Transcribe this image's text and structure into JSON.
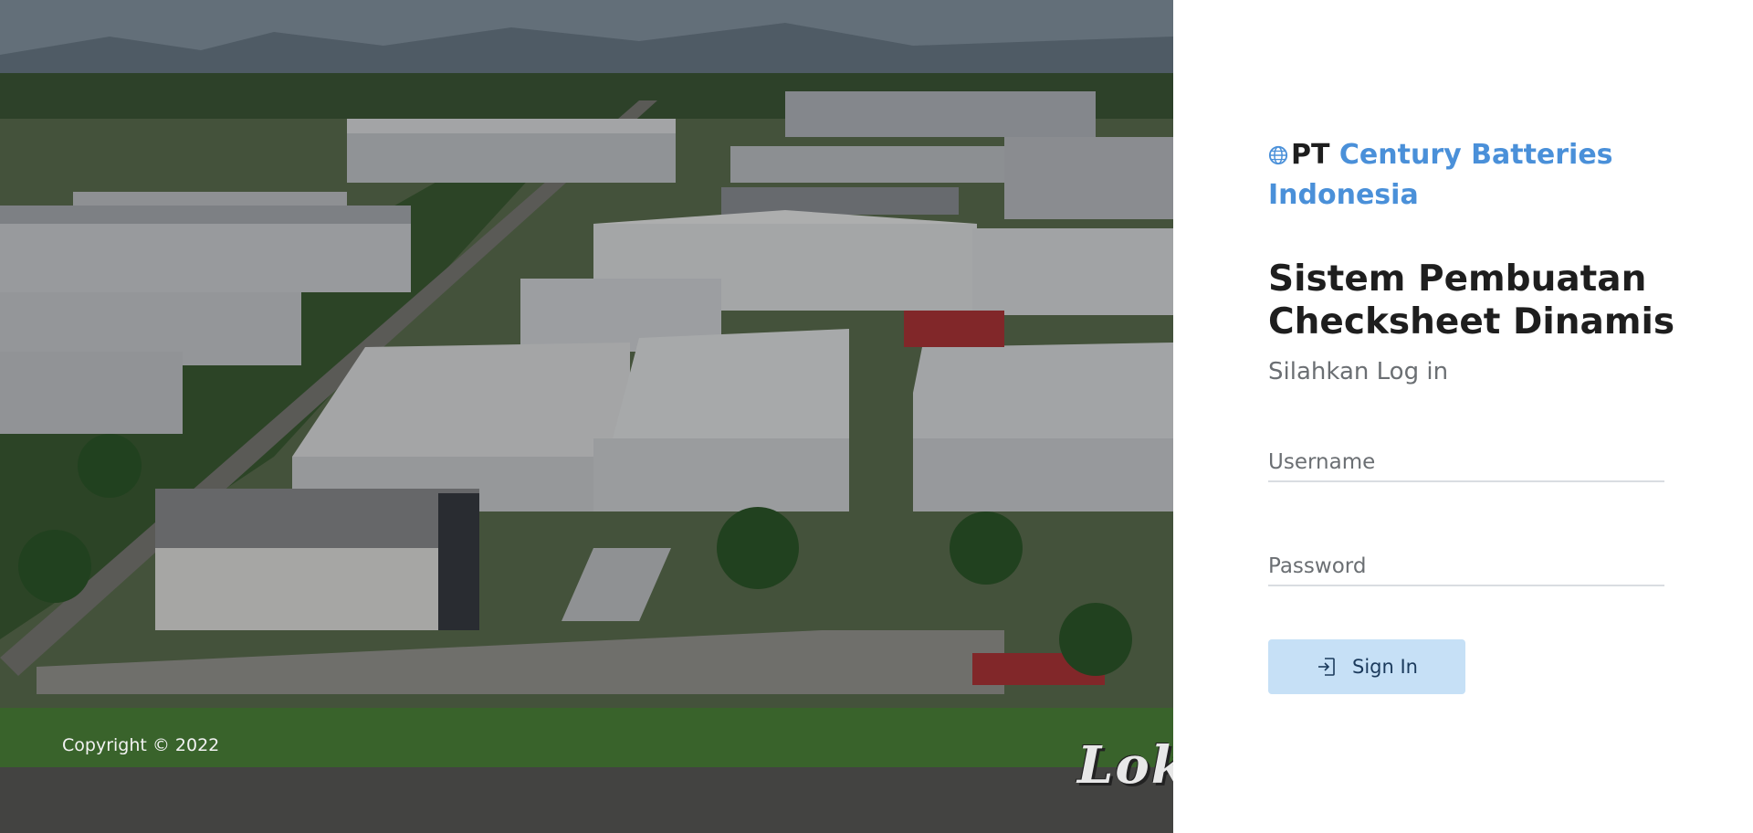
{
  "hero": {
    "copyright": "Copyright © 2022",
    "watermark": "Lok"
  },
  "login": {
    "company_prefix": "PT",
    "company_name": "Century Batteries Indonesia",
    "title": "Sistem Pembuatan Checksheet Dinamis",
    "subtitle": "Silahkan Log in",
    "username_placeholder": "Username",
    "password_placeholder": "Password",
    "signin_label": "Sign In"
  },
  "icons": {
    "company": "globe-icon",
    "signin": "sign-in-icon"
  },
  "colors": {
    "accent": "#4a90d9",
    "button_bg": "#c6e0f6",
    "button_text": "#1b3a5c",
    "title_text": "#1e1e1e",
    "muted_text": "#6b6f73"
  }
}
